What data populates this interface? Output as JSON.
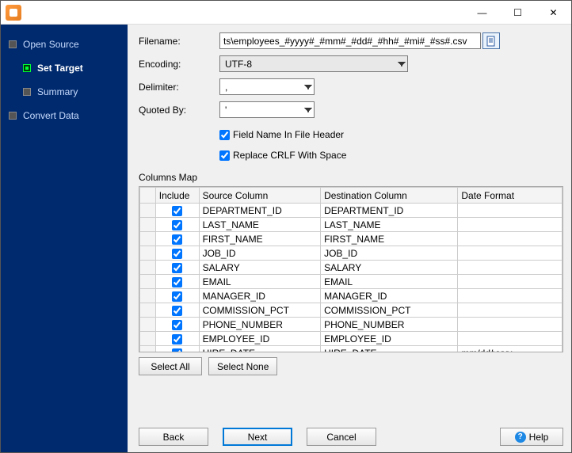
{
  "titlebar": {
    "min": "—",
    "max": "☐",
    "close": "✕"
  },
  "sidebar": {
    "steps": [
      {
        "label": "Open Source"
      },
      {
        "label": "Set Target"
      },
      {
        "label": "Summary"
      },
      {
        "label": "Convert Data"
      }
    ]
  },
  "form": {
    "filename_label": "Filename:",
    "filename_value": "ts\\employees_#yyyy#_#mm#_#dd#_#hh#_#mi#_#ss#.csv",
    "browse_icon": "doc-icon",
    "encoding_label": "Encoding:",
    "encoding_value": "UTF-8",
    "delimiter_label": "Delimiter:",
    "delimiter_value": ",",
    "quoted_label": "Quoted By:",
    "quoted_value": "'",
    "field_header_label": "Field Name In File Header",
    "replace_crlf_label": "Replace CRLF With Space"
  },
  "columns_map_label": "Columns Map",
  "table": {
    "headers": {
      "include": "Include",
      "source": "Source Column",
      "dest": "Destination Column",
      "fmt": "Date Format"
    },
    "rows": [
      {
        "src": "DEPARTMENT_ID",
        "dst": "DEPARTMENT_ID",
        "fmt": ""
      },
      {
        "src": "LAST_NAME",
        "dst": "LAST_NAME",
        "fmt": ""
      },
      {
        "src": "FIRST_NAME",
        "dst": "FIRST_NAME",
        "fmt": ""
      },
      {
        "src": "JOB_ID",
        "dst": "JOB_ID",
        "fmt": ""
      },
      {
        "src": "SALARY",
        "dst": "SALARY",
        "fmt": ""
      },
      {
        "src": "EMAIL",
        "dst": "EMAIL",
        "fmt": ""
      },
      {
        "src": "MANAGER_ID",
        "dst": "MANAGER_ID",
        "fmt": ""
      },
      {
        "src": "COMMISSION_PCT",
        "dst": "COMMISSION_PCT",
        "fmt": ""
      },
      {
        "src": "PHONE_NUMBER",
        "dst": "PHONE_NUMBER",
        "fmt": ""
      },
      {
        "src": "EMPLOYEE_ID",
        "dst": "EMPLOYEE_ID",
        "fmt": ""
      },
      {
        "src": "HIRE_DATE",
        "dst": "HIRE_DATE",
        "fmt": "mm/dd/yyyy"
      }
    ]
  },
  "buttons": {
    "select_all": "Select All",
    "select_none": "Select None",
    "back": "Back",
    "next": "Next",
    "cancel": "Cancel",
    "help": "Help"
  }
}
